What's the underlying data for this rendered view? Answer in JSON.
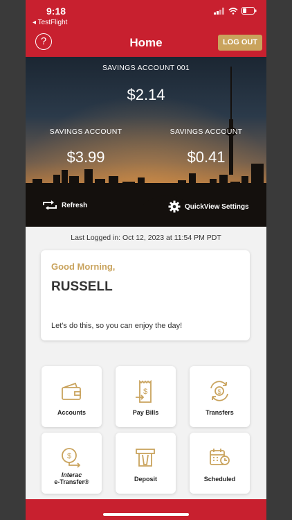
{
  "status": {
    "time": "9:18",
    "back_app": "◂ TestFlight"
  },
  "header": {
    "title": "Home",
    "logout_label": "LOG OUT",
    "help_label": "?"
  },
  "accounts": {
    "top": {
      "name": "SAVINGS ACCOUNT 001",
      "balance": "$2.14"
    },
    "left": {
      "name": "SAVINGS ACCOUNT",
      "balance": "$3.99"
    },
    "right": {
      "name": "SAVINGS ACCOUNT",
      "balance": "$0.41"
    }
  },
  "hero_actions": {
    "refresh": "Refresh",
    "quickview": "QuickView Settings"
  },
  "last_logged": "Last Logged in: Oct 12, 2023 at 11:54 PM  PDT",
  "greeting": {
    "salutation": "Good Morning,",
    "name": "RUSSELL",
    "message": "Let's do this, so you can enjoy the day!"
  },
  "tiles": [
    {
      "label": "Accounts",
      "icon": "wallet-icon"
    },
    {
      "label": "Pay Bills",
      "icon": "bill-icon"
    },
    {
      "label": "Transfers",
      "icon": "transfer-icon"
    },
    {
      "label_line1": "Interac",
      "label_line2": "e-Transfer®",
      "icon": "e-transfer-icon"
    },
    {
      "label": "Deposit",
      "icon": "deposit-icon"
    },
    {
      "label": "Scheduled",
      "icon": "calendar-clock-icon"
    }
  ],
  "colors": {
    "brand_red": "#c8202f",
    "gold": "#c9a35d"
  }
}
